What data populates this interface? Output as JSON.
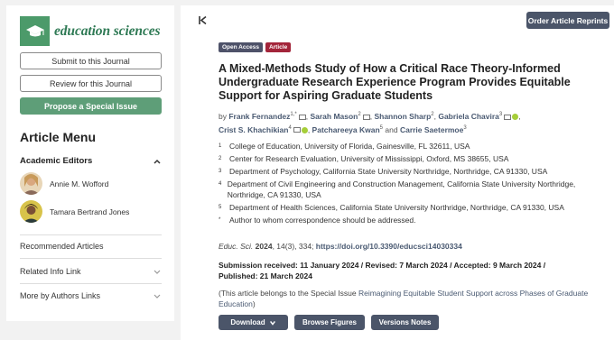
{
  "sidebar": {
    "logo_text": "education sciences",
    "buttons": {
      "submit": "Submit to this Journal",
      "review": "Review for this Journal",
      "propose": "Propose a Special Issue"
    },
    "menu_title": "Article Menu",
    "academic_editors_label": "Academic Editors",
    "editors": [
      "Annie M. Wofford",
      "Tamara Bertrand Jones"
    ],
    "items": [
      "Recommended Articles",
      "Related Info Link",
      "More by Authors Links"
    ]
  },
  "main": {
    "collapse_icon": "collapse-left-icon",
    "reprints_button": "Order Article Reprints",
    "badges": {
      "open_access": "Open Access",
      "article": "Article"
    },
    "title": "A Mixed-Methods Study of How a Critical Race Theory-Informed Undergraduate Research Experience Program Provides Equitable Support for Aspiring Graduate Students",
    "authors_prefix": "by",
    "authors": [
      {
        "name": "Frank Fernandez",
        "sup": "1,*"
      },
      {
        "name": "Sarah Mason",
        "sup": "2"
      },
      {
        "name": "Shannon Sharp",
        "sup": "2"
      },
      {
        "name": "Gabriela Chavira",
        "sup": "3"
      },
      {
        "name": "Crist S. Khachikian",
        "sup": "4"
      },
      {
        "name": "Patchareeya Kwan",
        "sup": "5"
      },
      {
        "name": "Carrie Saetermoe",
        "sup": "3"
      }
    ],
    "authors_and": "and",
    "affiliations": [
      {
        "num": "1",
        "text": "College of Education, University of Florida, Gainesville, FL 32611, USA"
      },
      {
        "num": "2",
        "text": "Center for Research Evaluation, University of Mississippi, Oxford, MS 38655, USA"
      },
      {
        "num": "3",
        "text": "Department of Psychology, California State University Northridge, Northridge, CA 91330, USA"
      },
      {
        "num": "4",
        "text": "Department of Civil Engineering and Construction Management, California State University Northridge, Northridge, CA 91330, USA"
      },
      {
        "num": "5",
        "text": "Department of Health Sciences, California State University Northridge, Northridge, CA 91330, USA"
      },
      {
        "num": "*",
        "text": "Author to whom correspondence should be addressed."
      }
    ],
    "citation": {
      "journal": "Educ. Sci.",
      "year": "2024",
      "volume_issue": ", 14(3), 334; ",
      "doi": "https://doi.org/10.3390/educsci14030334"
    },
    "dates": "Submission received: 11 January 2024 / Revised: 7 March 2024 / Accepted: 9 March 2024 / Published: 21 March 2024",
    "special_issue": {
      "prefix": "(This article belongs to the Special Issue ",
      "link": "Reimagining Equitable Student Support across Phases of Graduate Education",
      "suffix": ")"
    },
    "actions": {
      "download": "Download",
      "browse": "Browse Figures",
      "versions": "Versions Notes"
    }
  },
  "colors": {
    "brand_green": "#4c9a6a",
    "button_dark": "#4b5569",
    "article_badge": "#a3253a"
  }
}
